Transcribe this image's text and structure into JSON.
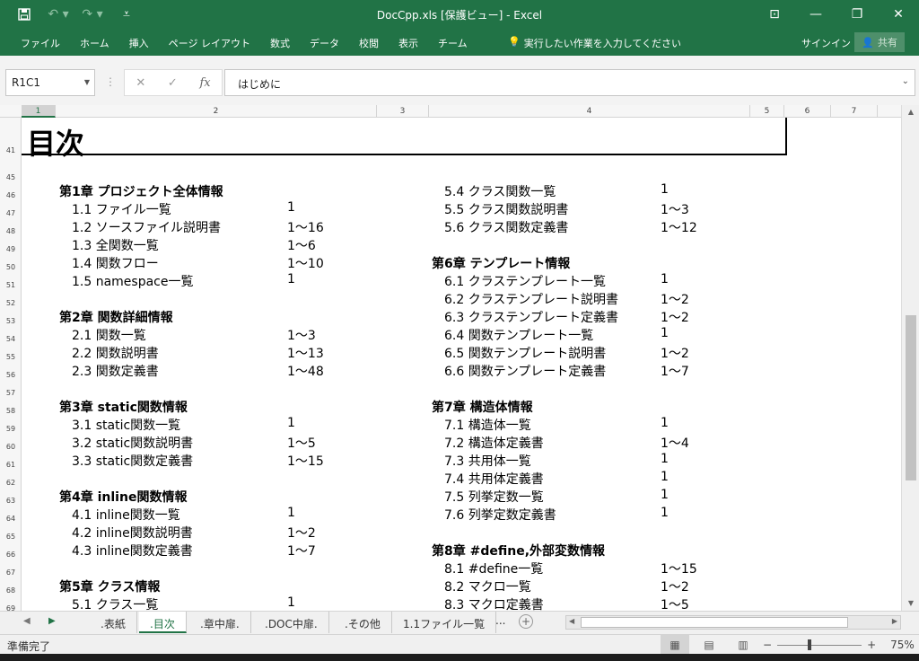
{
  "title_bar": {
    "title": "DocCpp.xls [保護ビュー] - Excel",
    "window_controls": [
      "ribbon-display-icon",
      "minimize-icon",
      "restore-icon",
      "close-icon"
    ]
  },
  "ribbon": {
    "tabs": [
      "ファイル",
      "ホーム",
      "挿入",
      "ページ レイアウト",
      "数式",
      "データ",
      "校閲",
      "表示",
      "チーム"
    ],
    "tell_me": "実行したい作業を入力してください",
    "sign_in": "サインイン",
    "share": "共有"
  },
  "formula_bar": {
    "name_box": "R1C1",
    "fx": "fx",
    "content": "はじめに"
  },
  "columns": [
    "1",
    "2",
    "3",
    "4",
    "5",
    "6",
    "7"
  ],
  "rows": [
    "41",
    "45",
    "46",
    "47",
    "48",
    "49",
    "50",
    "51",
    "52",
    "53",
    "54",
    "55",
    "56",
    "57",
    "58",
    "59",
    "60",
    "61",
    "62",
    "63",
    "64",
    "65",
    "66",
    "67",
    "68",
    "69"
  ],
  "heading": "目次",
  "toc_left": [
    {
      "text": "第1章 プロジェクト全体情報",
      "page": "",
      "chapter": true
    },
    {
      "text": "1.1 ファイル一覧",
      "page": "1",
      "chapter": false
    },
    {
      "text": "1.2 ソースファイル説明書",
      "page": "1～16",
      "chapter": false
    },
    {
      "text": "1.3 全関数一覧",
      "page": "1～6",
      "chapter": false
    },
    {
      "text": "1.4 関数フロー",
      "page": "1～10",
      "chapter": false
    },
    {
      "text": "1.5 namespace一覧",
      "page": "1",
      "chapter": false
    },
    {
      "text": "",
      "page": "",
      "chapter": false
    },
    {
      "text": "第2章 関数詳細情報",
      "page": "",
      "chapter": true
    },
    {
      "text": "2.1 関数一覧",
      "page": "1～3",
      "chapter": false
    },
    {
      "text": "2.2 関数説明書",
      "page": "1～13",
      "chapter": false
    },
    {
      "text": "2.3 関数定義書",
      "page": "1～48",
      "chapter": false
    },
    {
      "text": "",
      "page": "",
      "chapter": false
    },
    {
      "text": "第3章 static関数情報",
      "page": "",
      "chapter": true
    },
    {
      "text": "3.1 static関数一覧",
      "page": "1",
      "chapter": false
    },
    {
      "text": "3.2 static関数説明書",
      "page": "1～5",
      "chapter": false
    },
    {
      "text": "3.3 static関数定義書",
      "page": "1～15",
      "chapter": false
    },
    {
      "text": "",
      "page": "",
      "chapter": false
    },
    {
      "text": "第4章 inline関数情報",
      "page": "",
      "chapter": true
    },
    {
      "text": "4.1 inline関数一覧",
      "page": "1",
      "chapter": false
    },
    {
      "text": "4.2 inline関数説明書",
      "page": "1～2",
      "chapter": false
    },
    {
      "text": "4.3 inline関数定義書",
      "page": "1～7",
      "chapter": false
    },
    {
      "text": "",
      "page": "",
      "chapter": false
    },
    {
      "text": "第5章 クラス情報",
      "page": "",
      "chapter": true
    },
    {
      "text": "5.1 クラス一覧",
      "page": "1",
      "chapter": false
    }
  ],
  "toc_right": [
    {
      "text": "5.4 クラス関数一覧",
      "page": "1",
      "chapter": false
    },
    {
      "text": "5.5 クラス関数説明書",
      "page": "1～3",
      "chapter": false
    },
    {
      "text": "5.6 クラス関数定義書",
      "page": "1～12",
      "chapter": false
    },
    {
      "text": "",
      "page": "",
      "chapter": false
    },
    {
      "text": "第6章 テンプレート情報",
      "page": "",
      "chapter": true
    },
    {
      "text": "6.1 クラステンプレート一覧",
      "page": "1",
      "chapter": false
    },
    {
      "text": "6.2 クラステンプレート説明書",
      "page": "1～2",
      "chapter": false
    },
    {
      "text": "6.3 クラステンプレート定義書",
      "page": "1～2",
      "chapter": false
    },
    {
      "text": "6.4 関数テンプレート一覧",
      "page": "1",
      "chapter": false
    },
    {
      "text": "6.5 関数テンプレート説明書",
      "page": "1～2",
      "chapter": false
    },
    {
      "text": "6.6 関数テンプレート定義書",
      "page": "1～7",
      "chapter": false
    },
    {
      "text": "",
      "page": "",
      "chapter": false
    },
    {
      "text": "第7章 構造体情報",
      "page": "",
      "chapter": true
    },
    {
      "text": "7.1 構造体一覧",
      "page": "1",
      "chapter": false
    },
    {
      "text": "7.2 構造体定義書",
      "page": "1～4",
      "chapter": false
    },
    {
      "text": "7.3 共用体一覧",
      "page": "1",
      "chapter": false
    },
    {
      "text": "7.4 共用体定義書",
      "page": "1",
      "chapter": false
    },
    {
      "text": "7.5 列挙定数一覧",
      "page": "1",
      "chapter": false
    },
    {
      "text": "7.6 列挙定数定義書",
      "page": "1",
      "chapter": false
    },
    {
      "text": "",
      "page": "",
      "chapter": false
    },
    {
      "text": "第8章 #define,外部変数情報",
      "page": "",
      "chapter": true
    },
    {
      "text": "8.1 #define一覧",
      "page": "1～15",
      "chapter": false
    },
    {
      "text": "8.2 マクロ一覧",
      "page": "1～2",
      "chapter": false
    },
    {
      "text": "8.3 マクロ定義書",
      "page": "1～5",
      "chapter": false
    }
  ],
  "sheet_tabs": [
    {
      "label": ".表紙",
      "active": false
    },
    {
      "label": ".目次",
      "active": true
    },
    {
      "label": ".章中扉.",
      "active": false
    },
    {
      "label": ".DOC中扉.",
      "active": false
    },
    {
      "label": ".その他",
      "active": false
    },
    {
      "label": "1.1ファイル一覧",
      "active": false
    }
  ],
  "sheet_tabs_more": "...",
  "status": {
    "ready": "準備完了",
    "zoom": "75%"
  },
  "colors": {
    "excel_green": "#217346"
  }
}
